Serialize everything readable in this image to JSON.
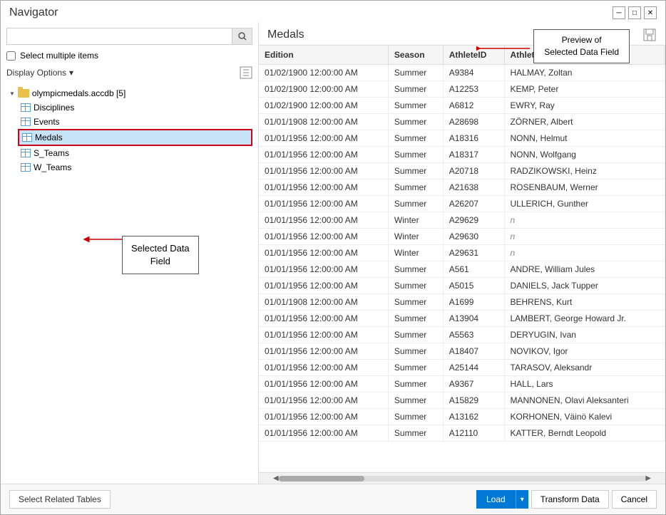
{
  "window": {
    "title": "Navigator",
    "minimize_label": "─",
    "maximize_label": "□",
    "close_label": "✕"
  },
  "left_panel": {
    "search_placeholder": "",
    "select_multiple_label": "Select multiple items",
    "display_options_label": "Display Options",
    "chevron": "▾",
    "database": {
      "name": "olympicmedals.accdb [5]",
      "tables": [
        {
          "name": "Disciplines"
        },
        {
          "name": "Events"
        },
        {
          "name": "Medals",
          "selected": true
        },
        {
          "name": "S_Teams"
        },
        {
          "name": "W_Teams"
        }
      ]
    },
    "callout_selected_field": "Selected Data\nField"
  },
  "right_panel": {
    "preview_title": "Medals",
    "annotation_preview": "Preview of\nSelected Data Field",
    "columns": [
      "Edition",
      "Season",
      "AthleteID",
      "Athlete"
    ],
    "rows": [
      [
        "01/02/1900 12:00:00 AM",
        "Summer",
        "A9384",
        "HALMAY, Zoltan"
      ],
      [
        "01/02/1900 12:00:00 AM",
        "Summer",
        "A12253",
        "KEMP, Peter"
      ],
      [
        "01/02/1900 12:00:00 AM",
        "Summer",
        "A6812",
        "EWRY, Ray"
      ],
      [
        "01/01/1908 12:00:00 AM",
        "Summer",
        "A28698",
        "ZÖRNER, Albert"
      ],
      [
        "01/01/1956 12:00:00 AM",
        "Summer",
        "A18316",
        "NONN, Helmut"
      ],
      [
        "01/01/1956 12:00:00 AM",
        "Summer",
        "A18317",
        "NONN, Wolfgang"
      ],
      [
        "01/01/1956 12:00:00 AM",
        "Summer",
        "A20718",
        "RADZIKOWSKI, Heinz"
      ],
      [
        "01/01/1956 12:00:00 AM",
        "Summer",
        "A21638",
        "ROSENBAUM, Werner"
      ],
      [
        "01/01/1956 12:00:00 AM",
        "Summer",
        "A26207",
        "ULLERICH, Gunther"
      ],
      [
        "01/01/1956 12:00:00 AM",
        "Winter",
        "A29629",
        ""
      ],
      [
        "01/01/1956 12:00:00 AM",
        "Winter",
        "A29630",
        ""
      ],
      [
        "01/01/1956 12:00:00 AM",
        "Winter",
        "A29631",
        ""
      ],
      [
        "01/01/1956 12:00:00 AM",
        "Summer",
        "A561",
        "ANDRE, William Jules"
      ],
      [
        "01/01/1956 12:00:00 AM",
        "Summer",
        "A5015",
        "DANIELS, Jack Tupper"
      ],
      [
        "01/01/1908 12:00:00 AM",
        "Summer",
        "A1699",
        "BEHRENS, Kurt"
      ],
      [
        "01/01/1956 12:00:00 AM",
        "Summer",
        "A13904",
        "LAMBERT, George Howard Jr."
      ],
      [
        "01/01/1956 12:00:00 AM",
        "Summer",
        "A5563",
        "DERYUGIN, Ivan"
      ],
      [
        "01/01/1956 12:00:00 AM",
        "Summer",
        "A18407",
        "NOVIKOV, Igor"
      ],
      [
        "01/01/1956 12:00:00 AM",
        "Summer",
        "A25144",
        "TARASOV, Aleksandr"
      ],
      [
        "01/01/1956 12:00:00 AM",
        "Summer",
        "A9367",
        "HALL, Lars"
      ],
      [
        "01/01/1956 12:00:00 AM",
        "Summer",
        "A15829",
        "MANNONEN, Olavi Aleksanteri"
      ],
      [
        "01/01/1956 12:00:00 AM",
        "Summer",
        "A13162",
        "KORHONEN, Väinö Kalevi"
      ],
      [
        "01/01/1956 12:00:00 AM",
        "Summer",
        "A12110",
        "KATTER, Berndt Leopold"
      ]
    ]
  },
  "bottom_bar": {
    "select_related_tables_label": "Select Related Tables",
    "load_label": "Load",
    "load_dropdown_arrow": "▾",
    "transform_data_label": "Transform Data",
    "cancel_label": "Cancel"
  }
}
